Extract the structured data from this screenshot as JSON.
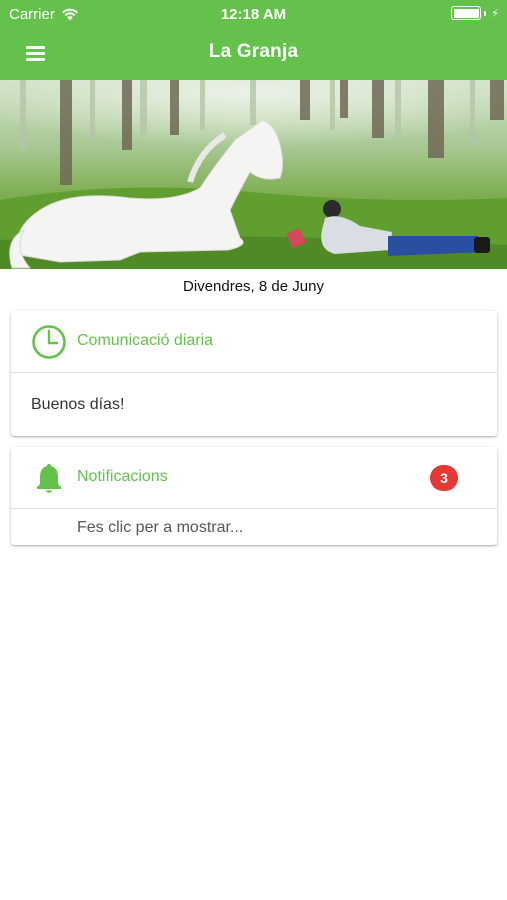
{
  "status_bar": {
    "carrier": "Carrier",
    "time": "12:18 AM"
  },
  "navbar": {
    "title": "La Granja",
    "menu_icon": "hamburger-icon"
  },
  "theme": {
    "accent": "#64c14c",
    "badge_color": "#e53935"
  },
  "date_line": "Divendres, 8 de Juny",
  "daily_card": {
    "icon": "clock-icon",
    "title": "Comunicació diaria",
    "message": "Buenos días!"
  },
  "notifications_card": {
    "icon": "bell-icon",
    "title": "Notificacions",
    "badge_count": "3",
    "tap_text": "Fes clic per a mostrar..."
  }
}
